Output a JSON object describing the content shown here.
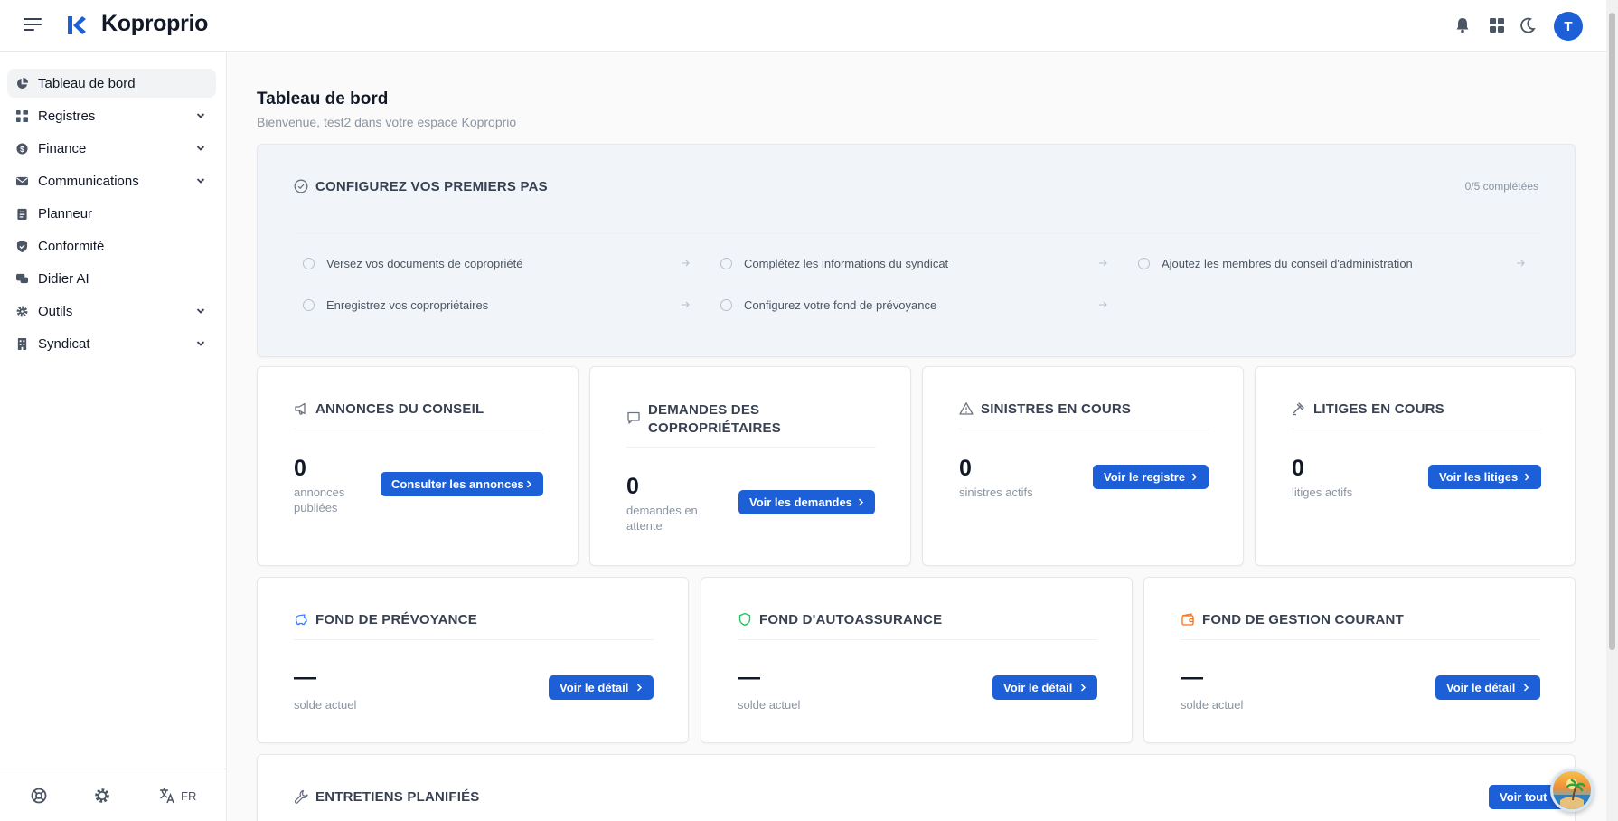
{
  "header": {
    "brand": "Koproprio",
    "avatar_initial": "T",
    "icons": [
      "menu-icon",
      "bell-icon",
      "grid-icon",
      "moon-icon"
    ]
  },
  "sidebar": {
    "items": [
      {
        "label": "Tableau de bord",
        "icon": "pie-chart-icon",
        "expandable": false,
        "active": true
      },
      {
        "label": "Registres",
        "icon": "registry-icon",
        "expandable": true
      },
      {
        "label": "Finance",
        "icon": "dollar-icon",
        "expandable": true
      },
      {
        "label": "Communications",
        "icon": "mail-icon",
        "expandable": true
      },
      {
        "label": "Planneur",
        "icon": "clipboard-icon",
        "expandable": false
      },
      {
        "label": "Conformité",
        "icon": "shield-check-icon",
        "expandable": false
      },
      {
        "label": "Didier AI",
        "icon": "chat-icon",
        "expandable": false
      },
      {
        "label": "Outils",
        "icon": "gear-icon",
        "expandable": true
      },
      {
        "label": "Syndicat",
        "icon": "building-icon",
        "expandable": true
      }
    ],
    "footer": {
      "language": "FR"
    }
  },
  "page": {
    "title": "Tableau de bord",
    "subtitle": "Bienvenue, test2 dans votre espace Koproprio"
  },
  "setup": {
    "title": "CONFIGUREZ VOS PREMIERS PAS",
    "progress": "0/5 complétées",
    "steps": [
      "Versez vos documents de copropriété",
      "Complétez les informations du syndicat",
      "Ajoutez les membres du conseil d'administration",
      "Enregistrez vos copropriétaires",
      "Configurez votre fond de prévoyance"
    ]
  },
  "stats": [
    {
      "title": "ANNONCES DU CONSEIL",
      "value": "0",
      "label": "annonces publiées",
      "button": "Consulter les annonces",
      "icon": "megaphone-icon"
    },
    {
      "title": "DEMANDES DES COPROPRIÉTAIRES",
      "value": "0",
      "label": "demandes en attente",
      "button": "Voir les demandes",
      "icon": "message-icon"
    },
    {
      "title": "SINISTRES EN COURS",
      "value": "0",
      "label": "sinistres actifs",
      "button": "Voir le registre",
      "icon": "warning-icon"
    },
    {
      "title": "LITIGES EN COURS",
      "value": "0",
      "label": "litiges actifs",
      "button": "Voir les litiges",
      "icon": "gavel-icon"
    }
  ],
  "funds": [
    {
      "title": "FOND DE PRÉVOYANCE",
      "value": "—",
      "label": "solde actuel",
      "button": "Voir le détail",
      "icon": "piggy-bank-icon",
      "icon_color": "#3b82f6"
    },
    {
      "title": "FOND D'AUTOASSURANCE",
      "value": "—",
      "label": "solde actuel",
      "button": "Voir le détail",
      "icon": "shield-icon",
      "icon_color": "#22c55e"
    },
    {
      "title": "FOND DE GESTION COURANT",
      "value": "—",
      "label": "solde actuel",
      "button": "Voir le détail",
      "icon": "wallet-icon",
      "icon_color": "#f97316"
    }
  ],
  "maintenance": {
    "title": "ENTRETIENS PLANIFIÉS",
    "button": "Voir tout",
    "icon": "wrench-icon"
  },
  "colors": {
    "primary": "#1d5fd6",
    "setup_bg": "#f1f5f9"
  }
}
